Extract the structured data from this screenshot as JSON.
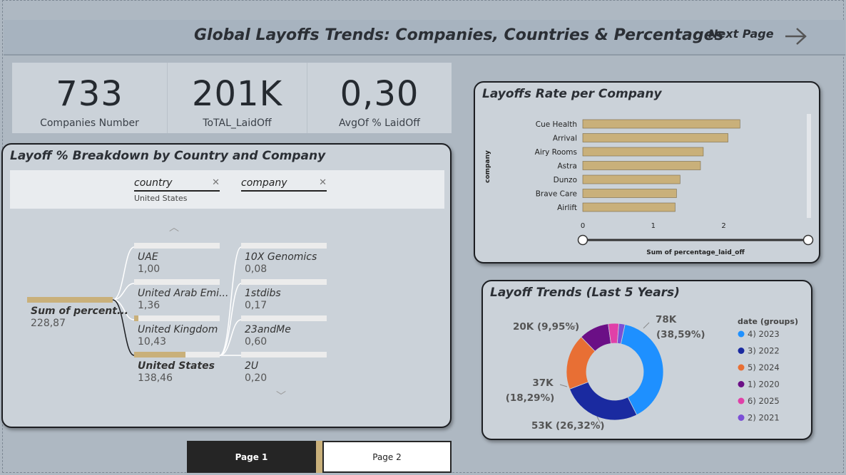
{
  "header": {
    "title": "Global Layoffs Trends: Companies, Countries & Percentages",
    "next_page_label": "Next Page"
  },
  "kpis": [
    {
      "value": "733",
      "label": "Companies Number"
    },
    {
      "value": "201K",
      "label": "ToTAL_LaidOff"
    },
    {
      "value": "0,30",
      "label": "AvgOf % LaidOff"
    }
  ],
  "tree": {
    "title": "Layoff % Breakdown by Country and Company",
    "filters": [
      {
        "label": "country",
        "selected": "United States"
      },
      {
        "label": "company",
        "selected": ""
      }
    ],
    "root": {
      "label": "Sum of percent...",
      "value": "228,87",
      "fill": 1.0
    },
    "countries": [
      {
        "label": "UAE",
        "value": "1,00",
        "fill": 0.0
      },
      {
        "label": "United Arab Emi...",
        "value": "1,36",
        "fill": 0.0
      },
      {
        "label": "United Kingdom",
        "value": "10,43",
        "fill": 0.05
      },
      {
        "label": "United States",
        "value": "138,46",
        "fill": 0.6
      }
    ],
    "companies": [
      {
        "label": "10X Genomics",
        "value": "0,08",
        "fill": 0.0
      },
      {
        "label": "1stdibs",
        "value": "0,17",
        "fill": 0.0
      },
      {
        "label": "23andMe",
        "value": "0,60",
        "fill": 0.0
      },
      {
        "label": "2U",
        "value": "0,20",
        "fill": 0.0
      }
    ]
  },
  "chart_data": [
    {
      "type": "bar",
      "title": "Layoffs Rate per Company",
      "xlabel": "Sum of percentage_laid_off",
      "ylabel": "company",
      "categories": [
        "Cue Health",
        "Arrival",
        "Airy Rooms",
        "Astra",
        "Dunzo",
        "Brave Care",
        "Airlift"
      ],
      "values": [
        2.23,
        2.06,
        1.71,
        1.67,
        1.38,
        1.33,
        1.31
      ],
      "xlim": [
        0,
        2.5
      ],
      "xticks": [
        "0",
        "1",
        "2"
      ],
      "bar_color": "#c9b07a"
    },
    {
      "type": "pie",
      "title": "Layoff Trends (Last 5 Years)",
      "legend_title": "date (groups)",
      "legend_position": "right",
      "slices": [
        {
          "name": "4) 2023",
          "value": 78,
          "label": "78K",
          "pct": "(38,59%)",
          "color": "#1e90ff"
        },
        {
          "name": "3) 2022",
          "value": 53,
          "label": "53K (26,32%)",
          "pct": "",
          "color": "#1a2aa0"
        },
        {
          "name": "5) 2024",
          "value": 37,
          "label": "37K",
          "pct": "(18,29%)",
          "color": "#e86f34"
        },
        {
          "name": "1) 2020",
          "value": 20,
          "label": "20K (9,95%)",
          "pct": "",
          "color": "#6b0f86"
        },
        {
          "name": "6) 2025",
          "value": 7,
          "label": "",
          "pct": "",
          "color": "#e040a8"
        },
        {
          "name": "2) 2021",
          "value": 4,
          "label": "",
          "pct": "",
          "color": "#7b4fd6"
        }
      ]
    }
  ],
  "pages": [
    {
      "label": "Page 1",
      "active": true
    },
    {
      "label": "Page 2",
      "active": false
    }
  ]
}
